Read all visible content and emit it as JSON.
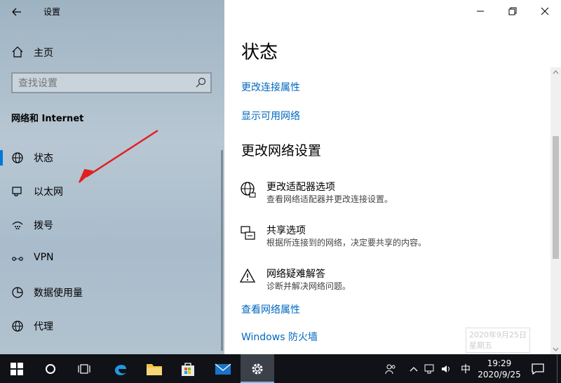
{
  "window": {
    "title": "设置"
  },
  "sidebar": {
    "home": "主页",
    "search_placeholder": "查找设置",
    "section_title": "网络和 Internet",
    "items": [
      {
        "label": "状态",
        "icon": "globe-icon"
      },
      {
        "label": "以太网",
        "icon": "ethernet-icon"
      },
      {
        "label": "拨号",
        "icon": "dialup-icon"
      },
      {
        "label": "VPN",
        "icon": "vpn-icon"
      },
      {
        "label": "数据使用量",
        "icon": "data-usage-icon"
      },
      {
        "label": "代理",
        "icon": "globe-icon"
      }
    ]
  },
  "main": {
    "heading": "状态",
    "links_top": [
      "更改连接属性",
      "显示可用网络"
    ],
    "section_heading": "更改网络设置",
    "settings": [
      {
        "title": "更改适配器选项",
        "desc": "查看网络适配器并更改连接设置。",
        "icon": "globe-icon"
      },
      {
        "title": "共享选项",
        "desc": "根据所连接到的网络，决定要共享的内容。",
        "icon": "sharing-icon"
      },
      {
        "title": "网络疑难解答",
        "desc": "诊断并解决网络问题。",
        "icon": "warning-icon"
      }
    ],
    "links_bottom": [
      "查看网络属性",
      "Windows 防火墙"
    ],
    "watermark": [
      "2020年9月25日",
      "星期五"
    ]
  },
  "taskbar": {
    "time": "19:29",
    "date": "2020/9/25",
    "ime": "中"
  },
  "colors": {
    "accent": "#0067c0",
    "taskbar": "#101218",
    "active_marker": "#0078d7"
  }
}
